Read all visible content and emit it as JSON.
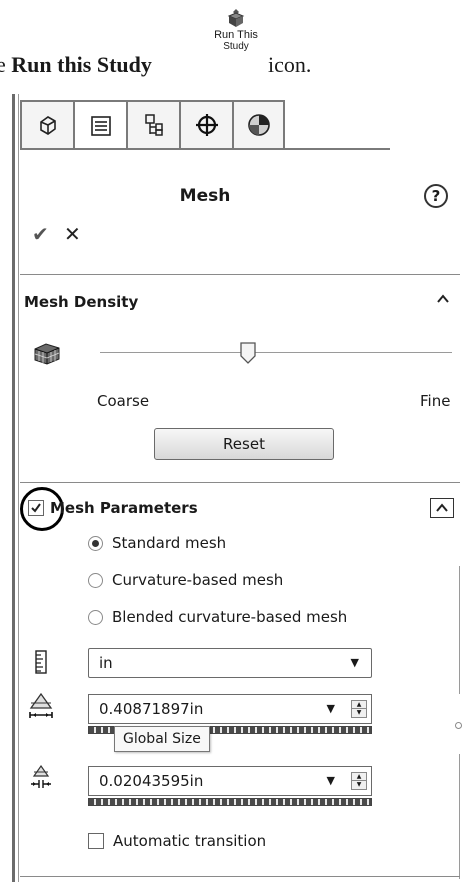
{
  "instruction": {
    "prefix": "e ",
    "bold": "Run this Study",
    "suffix": " icon."
  },
  "toolbar_icon": {
    "icon": "run-study-icon",
    "label_line1": "Run This",
    "label_line2": "Study"
  },
  "tabs": [
    {
      "icon": "feature-manager-icon",
      "active": false
    },
    {
      "icon": "property-manager-icon",
      "active": true
    },
    {
      "icon": "configuration-manager-icon",
      "active": false
    },
    {
      "icon": "dimxpert-icon",
      "active": false
    },
    {
      "icon": "display-manager-icon",
      "active": false
    }
  ],
  "panel": {
    "title": "Mesh",
    "help_glyph": "?",
    "ok_glyph": "✔",
    "cancel_glyph": "✕"
  },
  "mesh_density": {
    "header": "Mesh Density",
    "coarse_label": "Coarse",
    "fine_label": "Fine",
    "slider_level": 0.42,
    "reset_label": "Reset"
  },
  "mesh_parameters": {
    "header": "Mesh Parameters",
    "checked": true,
    "options": [
      {
        "label": "Standard mesh",
        "selected": true
      },
      {
        "label": "Curvature-based mesh",
        "selected": false
      },
      {
        "label": "Blended curvature-based mesh",
        "selected": false
      }
    ],
    "unit": "in",
    "global_size": "0.40871897in",
    "global_size_tooltip": "Global Size",
    "tolerance": "0.02043595in",
    "automatic_transition_label": "Automatic transition",
    "automatic_transition_checked": false
  }
}
